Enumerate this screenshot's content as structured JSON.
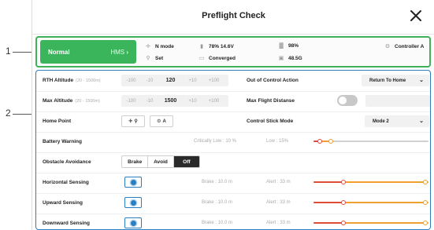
{
  "callouts": {
    "one": "1",
    "two": "2"
  },
  "header": {
    "title": "Preflight Check"
  },
  "status": {
    "state": "Normal",
    "hms": "HMS",
    "mode": "N mode",
    "battery": "78% 14.6V",
    "signal": "98%",
    "controller": "Controller A",
    "home": "Set",
    "rtk": "Converged",
    "storage": "48.5G"
  },
  "rows": {
    "rth": {
      "label": "RTH Altitude",
      "range": "(20 - 1500m)",
      "m100": "-100",
      "m10": "-10",
      "value": "120",
      "p10": "+10",
      "p100": "+100"
    },
    "maxalt": {
      "label": "Max Altitude",
      "range": "(20 - 1500m)",
      "m100": "-100",
      "m10": "-10",
      "value": "1500",
      "p10": "+10",
      "p100": "+100"
    },
    "ooc": {
      "label": "Out of Control Action",
      "value": "Return To Home"
    },
    "maxdist": {
      "label": "Max Flight Distanse"
    },
    "home": {
      "label": "Home Point",
      "btn2": "A"
    },
    "stick": {
      "label": "Control Stick Mode",
      "value": "Mode 2"
    },
    "battery": {
      "label": "Battery Warning",
      "critical": "Critically Low : 10 %",
      "low": "Low : 15%",
      "critical_value": 10,
      "low_value": 15
    },
    "obstacle": {
      "label": "Obstacle Avoidance",
      "options": [
        "Brake",
        "Avoid",
        "Off"
      ],
      "selected": "Off"
    },
    "horizontal": {
      "label": "Horizontal Sensing",
      "brake": "Brake : 10.0 m",
      "alert": "Alert : 33 m"
    },
    "upward": {
      "label": "Upward Sensing",
      "brake": "Brake : 10.0 m",
      "alert": "Alert : 33 m"
    },
    "downward": {
      "label": "Downward Sensing",
      "brake": "Brake : 10.0 m",
      "alert": "Alert : 33 m"
    }
  },
  "colors": {
    "normal": "#3ab55b",
    "highlight": "#2b7fc1",
    "warn_red": "#e04a3b",
    "warn_orange": "#f0a030"
  }
}
